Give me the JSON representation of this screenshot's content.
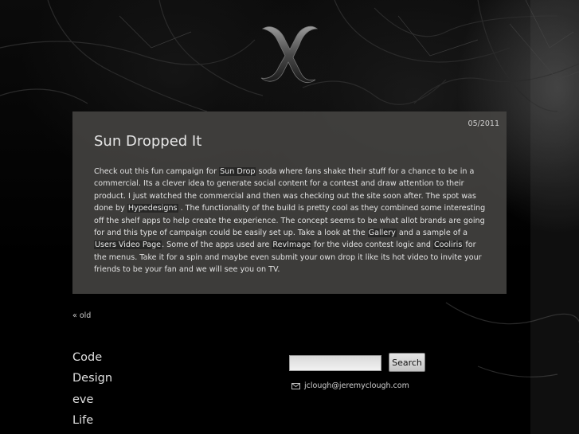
{
  "post": {
    "date": "05/2011",
    "title": "Sun Dropped It",
    "body": [
      {
        "text": "Check out this fun campaign for "
      },
      {
        "link": "Sun Drop",
        "name": "link-sun-drop"
      },
      {
        "text": " soda where fans shake their stuff for a chance to be in a commercial. Its a clever idea to generate social content for a contest and draw attention to their product. I just watched the commercial and then was checking out the site soon after. The spot was done by "
      },
      {
        "link": "Hypedesigns",
        "name": "link-hypedesigns"
      },
      {
        "text": " . The functionality of the build is pretty cool as they combined some interesting off the shelf apps to help create the experience. The concept seems to be what allot brands are going for and this type of campaign could be easily set up. Take a look at the "
      },
      {
        "link": "Gallery",
        "name": "link-gallery"
      },
      {
        "text": " and a sample of a "
      },
      {
        "link": "Users Video Page",
        "name": "link-users-video-page"
      },
      {
        "text": ". Some of the apps used are "
      },
      {
        "link": "RevImage",
        "name": "link-revimage"
      },
      {
        "text": " for the video contest logic and "
      },
      {
        "link": "Cooliris",
        "name": "link-cooliris"
      },
      {
        "text": " for the menus. Take it for a spin and maybe even submit your own drop it like its hot video to invite your friends to be your fan and we will see you on TV."
      }
    ]
  },
  "nav": {
    "older": "« old"
  },
  "categories": [
    "Code",
    "Design",
    "eve",
    "Life"
  ],
  "search": {
    "value": "",
    "button_label": "Search"
  },
  "contact": {
    "email": "jclough@jeremyclough.com",
    "icon": "mail-icon"
  },
  "colors": {
    "background": "#000000",
    "card": "#464442",
    "link_bg": "#232323"
  }
}
